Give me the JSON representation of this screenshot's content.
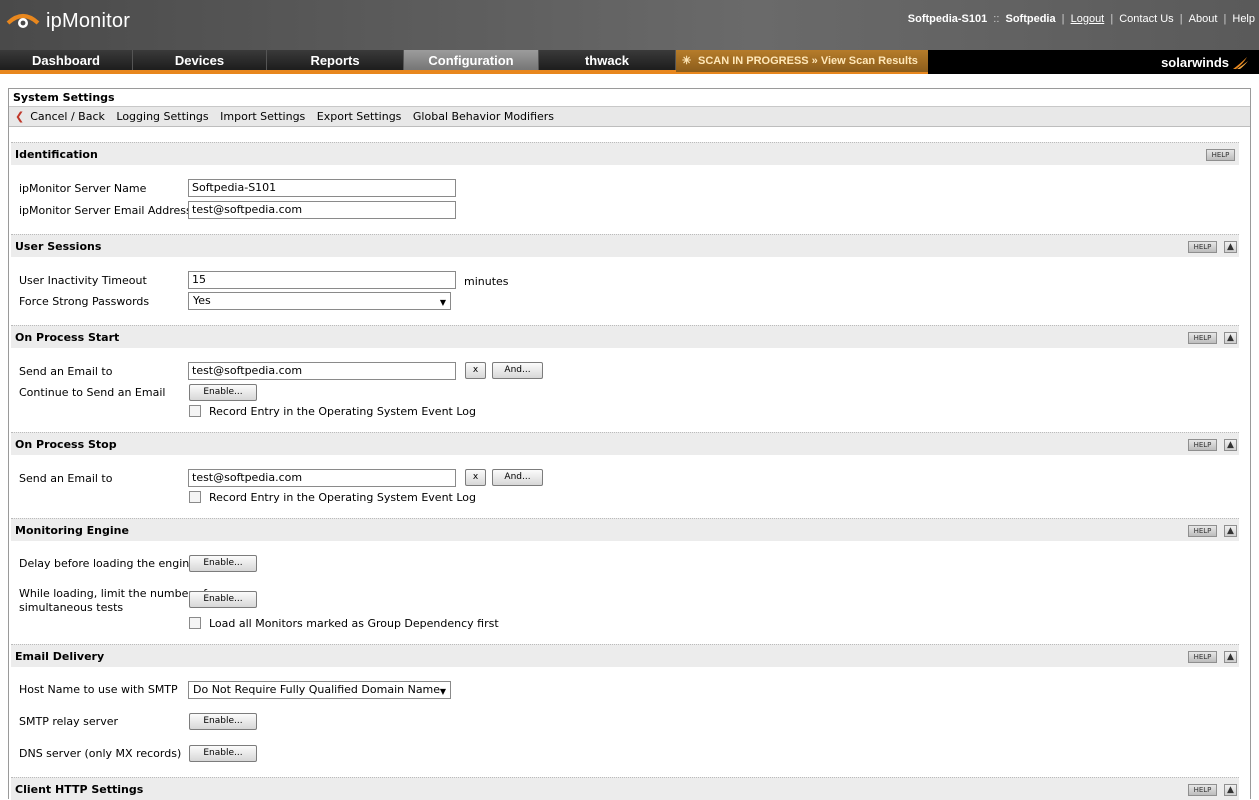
{
  "header": {
    "app_name": "ipMonitor",
    "server": "Softpedia-S101",
    "separator": "::",
    "user": "Softpedia",
    "links": [
      "Logout",
      "Contact Us",
      "About",
      "Help"
    ]
  },
  "nav": {
    "tabs": [
      "Dashboard",
      "Devices",
      "Reports",
      "Configuration",
      "thwack"
    ],
    "active_tab": "Configuration",
    "scan_status": "SCAN IN PROGRESS » View Scan Results",
    "brand": "solarwinds"
  },
  "colors": {
    "accent": "#e8871e",
    "nav_bg": "#000000",
    "section_bg": "#ececec"
  },
  "panel": {
    "title": "System Settings",
    "subnav": [
      "Cancel / Back",
      "Logging Settings",
      "Import Settings",
      "Export Settings",
      "Global Behavior Modifiers"
    ]
  },
  "help_label": "HELP",
  "sections": {
    "identification": {
      "title": "Identification",
      "server_name_label": "ipMonitor Server Name",
      "server_name_value": "Softpedia-S101",
      "email_label": "ipMonitor Server Email Address",
      "email_value": "test@softpedia.com"
    },
    "user_sessions": {
      "title": "User Sessions",
      "timeout_label": "User Inactivity Timeout",
      "timeout_value": "15",
      "timeout_unit": "minutes",
      "strong_pw_label": "Force Strong Passwords",
      "strong_pw_value": "Yes"
    },
    "process_start": {
      "title": "On Process Start",
      "send_email_label": "Send an Email to",
      "send_email_value": "test@softpedia.com",
      "clear_label": "x",
      "and_label": "And...",
      "continue_label": "Continue to Send an Email",
      "enable_label": "Enable...",
      "record_label": "Record Entry in the Operating System Event Log"
    },
    "process_stop": {
      "title": "On Process Stop",
      "send_email_label": "Send an Email to",
      "send_email_value": "test@softpedia.com",
      "clear_label": "x",
      "and_label": "And...",
      "record_label": "Record Entry in the Operating System Event Log"
    },
    "monitoring_engine": {
      "title": "Monitoring Engine",
      "delay_label": "Delay before loading the engine",
      "enable_label": "Enable...",
      "limit_label_1": "While loading, limit the number of",
      "limit_label_2": "simultaneous tests",
      "load_label": "Load all Monitors marked as Group Dependency first"
    },
    "email_delivery": {
      "title": "Email Delivery",
      "host_label": "Host Name to use with SMTP",
      "host_value": "Do Not Require Fully Qualified Domain Name",
      "relay_label": "SMTP relay server",
      "dns_label": "DNS server (only MX records)",
      "enable_label": "Enable..."
    },
    "client_http": {
      "title": "Client HTTP Settings"
    }
  }
}
